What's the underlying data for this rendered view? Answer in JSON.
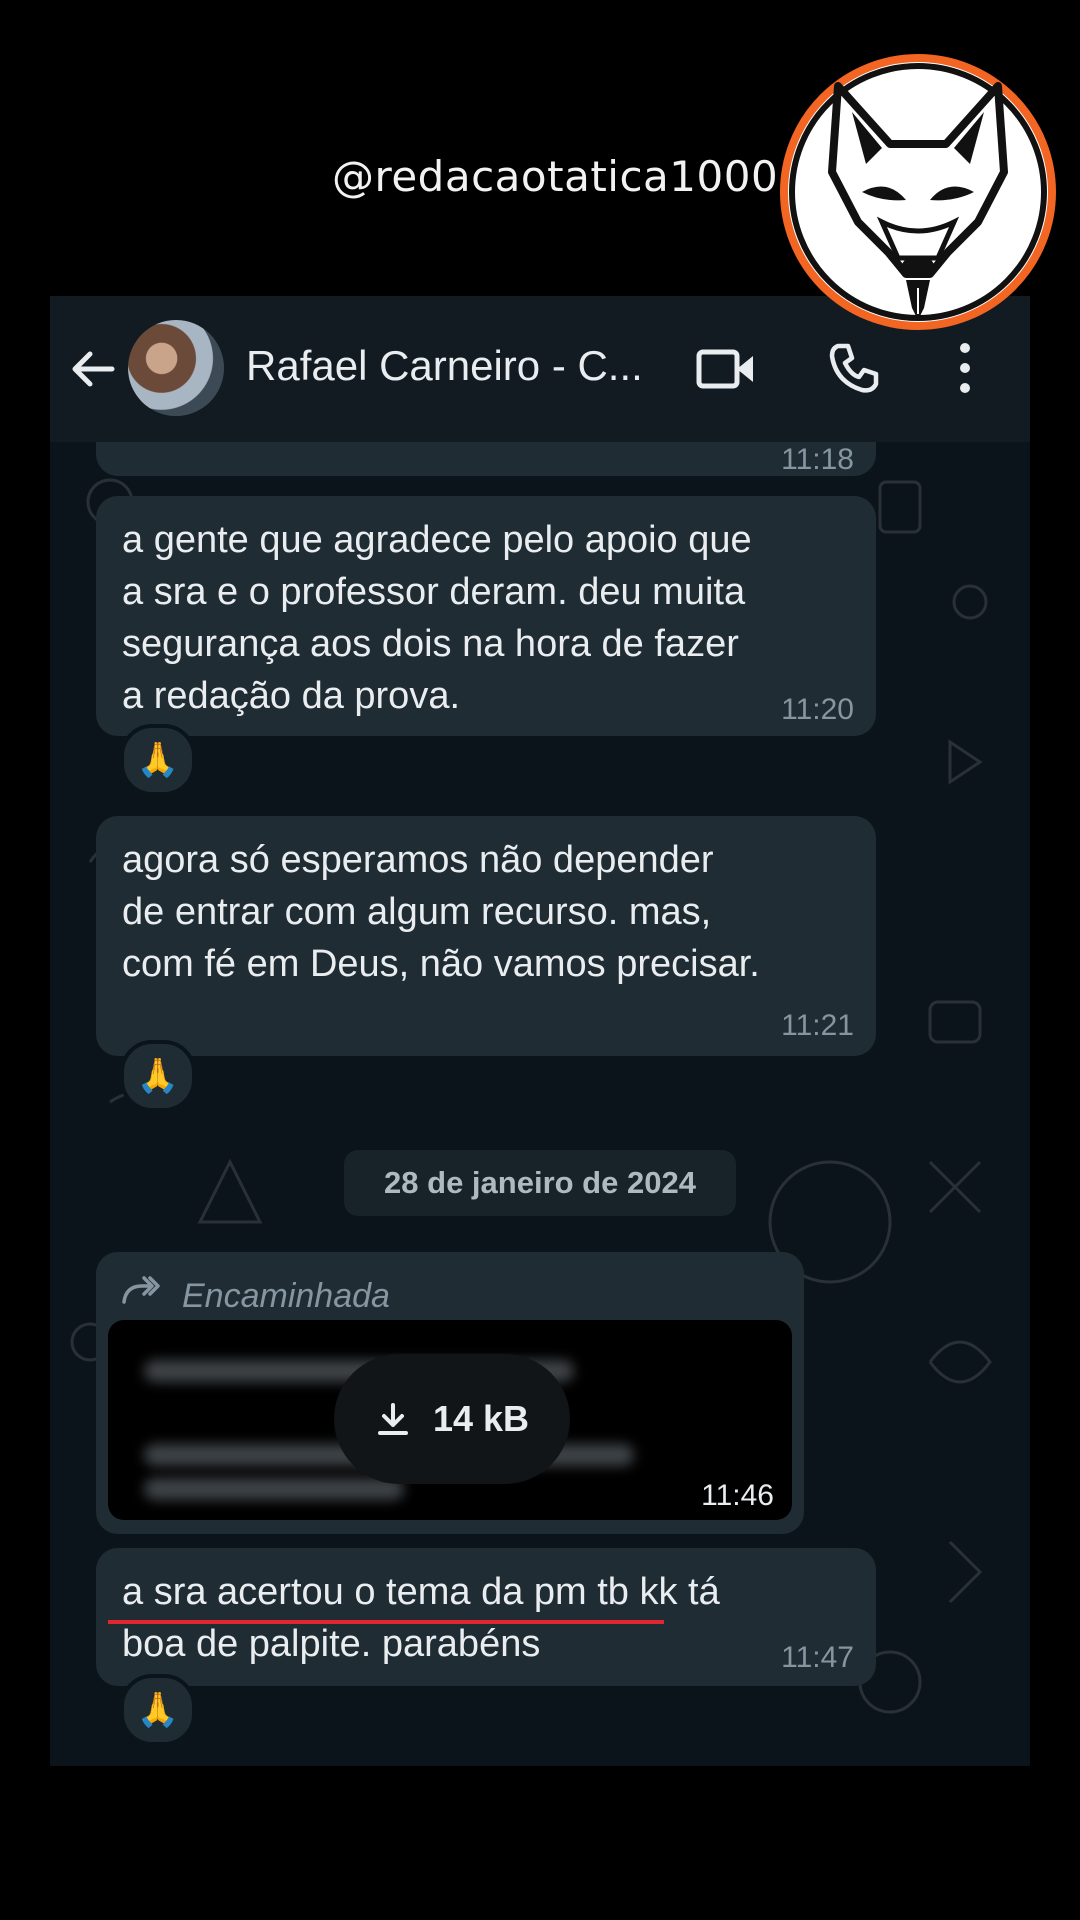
{
  "watermark": {
    "handle": "@redacaotatica1000"
  },
  "header": {
    "contact_name": "Rafael Carneiro - C..."
  },
  "messages": [
    {
      "time": "11:18"
    },
    {
      "text": "a gente que agradece pelo apoio que\na sra e o professor deram. deu muita\nsegurança aos dois na hora de fazer\na redação da prova.",
      "time": "11:20",
      "reaction": "🙏"
    },
    {
      "text": "agora só esperamos não depender\nde entrar com algum recurso. mas,\ncom fé em Deus, não vamos precisar.",
      "time": "11:21",
      "reaction": "🙏"
    },
    {
      "forwarded_label": "Encaminhada",
      "attachment_size": "14 kB",
      "time": "11:46"
    },
    {
      "text": "a sra acertou o tema da pm tb kk tá\nboa de palpite. parabéns",
      "time": "11:47",
      "reaction": "🙏"
    }
  ],
  "date_separator": "28 de janeiro de 2024",
  "colors": {
    "background": "#000000",
    "chat_bg": "#0b141a",
    "header_bg": "#111b21",
    "bubble_bg": "#202c33",
    "meta_text": "#8696a0",
    "underline": "#e0262e",
    "logo_ring": "#f26522"
  },
  "icons": [
    "back-arrow-icon",
    "video-call-icon",
    "phone-call-icon",
    "more-options-icon",
    "forward-icon",
    "download-icon",
    "fox-logo-icon"
  ]
}
